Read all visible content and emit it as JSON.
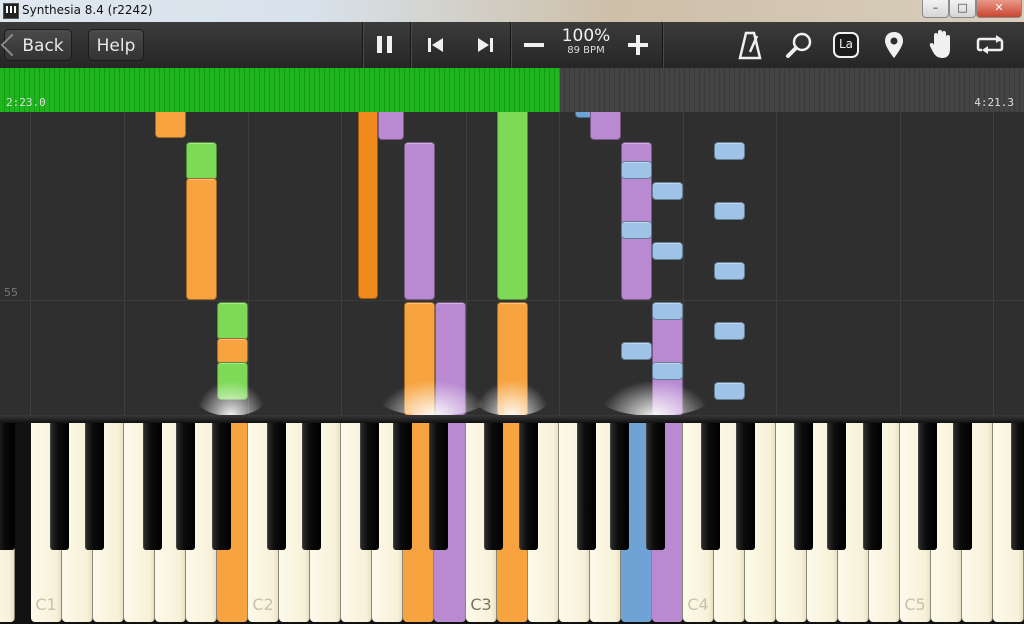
{
  "window": {
    "title": "Synthesia 8.4 (r2242)",
    "minimize": "–",
    "maximize": "□",
    "close": "✕"
  },
  "toolbar": {
    "back_label": "Back",
    "help_label": "Help",
    "speed_percent": "100%",
    "tempo": "89 BPM",
    "icons": [
      "pause-icon",
      "skip-back-icon",
      "skip-forward-icon",
      "minus-icon",
      "plus-icon",
      "metronome-icon",
      "magnifier-icon",
      "solfege-icon",
      "map-pin-icon",
      "hand-icon",
      "loop-icon"
    ],
    "solfege_label": "La"
  },
  "progress": {
    "current_time": "2:23.0",
    "total_time": "4:21.3",
    "played_fraction": 0.547
  },
  "roll": {
    "measure_number": "55"
  },
  "keyboard": {
    "labels": {
      "c1": "C1",
      "c2": "C2",
      "c3": "C3",
      "c4": "C4",
      "c5": "C5"
    }
  },
  "colors": {
    "green": "#7ed957",
    "orange": "#f7a440",
    "dark_orange": "#f08a1c",
    "purple": "#b98ad1",
    "blue": "#9ec3e6",
    "key_blue": "#6fa3d6",
    "progress_green": "#1fb51f"
  }
}
